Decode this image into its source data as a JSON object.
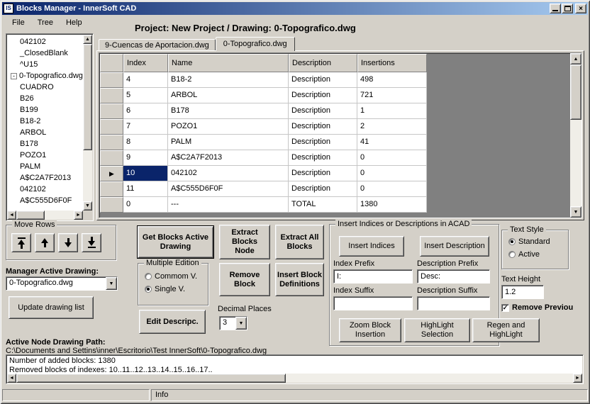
{
  "window": {
    "title": "Blocks Manager - InnerSoft CAD",
    "icon_text": "IS"
  },
  "colors": {
    "titlebar_start": "#0a246a",
    "titlebar_end": "#a6caf0",
    "selection": "#0a246a",
    "window_bg": "#d4d0c8"
  },
  "icons": {
    "dropdown": "▼",
    "scroll_up": "▲",
    "scroll_down": "▼",
    "scroll_left": "◄",
    "scroll_right": "►",
    "row_pointer": "▶",
    "check": "✓",
    "close": "×",
    "collapse": "-"
  },
  "menu": {
    "items": [
      "File",
      "Tree",
      "Help"
    ]
  },
  "project_header": "Project: New Project / Drawing: 0-Topografico.dwg",
  "tree": {
    "items": [
      {
        "label": "042102",
        "level": 1
      },
      {
        "label": "_ClosedBlank",
        "level": 1
      },
      {
        "label": "^U15",
        "level": 1
      },
      {
        "label": "0-Topografico.dwg",
        "level": 0,
        "expander": "-"
      },
      {
        "label": "CUADRO",
        "level": 1
      },
      {
        "label": "B26",
        "level": 1
      },
      {
        "label": "B199",
        "level": 1
      },
      {
        "label": "B18-2",
        "level": 1
      },
      {
        "label": "ARBOL",
        "level": 1
      },
      {
        "label": "B178",
        "level": 1
      },
      {
        "label": "POZO1",
        "level": 1
      },
      {
        "label": "PALM",
        "level": 1
      },
      {
        "label": "A$C2A7F2013",
        "level": 1
      },
      {
        "label": "042102",
        "level": 1
      },
      {
        "label": "A$C555D6F0F",
        "level": 1
      }
    ]
  },
  "tabs": [
    {
      "label": "9-Cuencas de Aportacion.dwg",
      "active": false
    },
    {
      "label": "0-Topografico.dwg",
      "active": true
    }
  ],
  "grid": {
    "columns": [
      "Index",
      "Name",
      "Description",
      "Insertions"
    ],
    "rows": [
      {
        "index": "4",
        "name": "B18-2",
        "description": "Description",
        "insertions": "498",
        "selected": false
      },
      {
        "index": "5",
        "name": "ARBOL",
        "description": "Description",
        "insertions": "721",
        "selected": false
      },
      {
        "index": "6",
        "name": "B178",
        "description": "Description",
        "insertions": "1",
        "selected": false
      },
      {
        "index": "7",
        "name": "POZO1",
        "description": "Description",
        "insertions": "2",
        "selected": false
      },
      {
        "index": "8",
        "name": "PALM",
        "description": "Description",
        "insertions": "41",
        "selected": false
      },
      {
        "index": "9",
        "name": "A$C2A7F2013",
        "description": "Description",
        "insertions": "0",
        "selected": false
      },
      {
        "index": "10",
        "name": "042102",
        "description": "Description",
        "insertions": "0",
        "selected": true
      },
      {
        "index": "11",
        "name": "A$C555D6F0F",
        "description": "Description",
        "insertions": "0",
        "selected": false
      },
      {
        "index": "0",
        "name": "---",
        "description": "TOTAL",
        "insertions": "1380",
        "selected": false
      }
    ]
  },
  "move_rows": {
    "title": "Move Rows"
  },
  "manager_drawing": {
    "label": "Manager Active Drawing:",
    "value": "0-Topografico.dwg",
    "update_button": "Update drawing list"
  },
  "actions": {
    "get_blocks": "Get Blocks Active Drawing",
    "extract_node": "Extract Blocks Node",
    "extract_all": "Extract All Blocks",
    "remove_block": "Remove Block",
    "insert_defs": "Insert Block Definitions",
    "edit_desc": "Edit Descripc."
  },
  "multiple_edition": {
    "title": "Multiple Edition",
    "options": [
      "Commom V.",
      "Single V."
    ],
    "selected": "Single V."
  },
  "decimal_places": {
    "label": "Decimal Places",
    "value": "3"
  },
  "acad_group": {
    "title": "Insert Indices or Descriptions in ACAD",
    "insert_indices": "Insert Indices",
    "insert_description": "Insert Description",
    "index_prefix_label": "Index Prefix",
    "index_prefix_value": "I:",
    "description_prefix_label": "Description Prefix",
    "description_prefix_value": "Desc:",
    "index_suffix_label": "Index Suffix",
    "index_suffix_value": "",
    "description_suffix_label": "Description Suffix",
    "description_suffix_value": "",
    "zoom_block": "Zoom Block Insertion",
    "highlight_selection": "HighLight Selection",
    "regen_highlight": "Regen and HighLight"
  },
  "text_style": {
    "title": "Text Style",
    "options": [
      "Standard",
      "Active"
    ],
    "selected": "Standard"
  },
  "text_height": {
    "label": "Text Height",
    "value": "1.2"
  },
  "remove_previous": {
    "label": "Remove Previou",
    "checked": true
  },
  "path_section": {
    "label": "Active Node Drawing Path:",
    "path": "C:\\Documents and Settins\\inner\\Escritorio\\Test InnerSoft\\0-Topografico.dwg"
  },
  "log": {
    "lines": [
      "Number of added blocks: 1380",
      "Removed blocks of indexes: 10..11..12..13..14..15..16..17.."
    ]
  },
  "statusbar": {
    "info": "Info"
  }
}
